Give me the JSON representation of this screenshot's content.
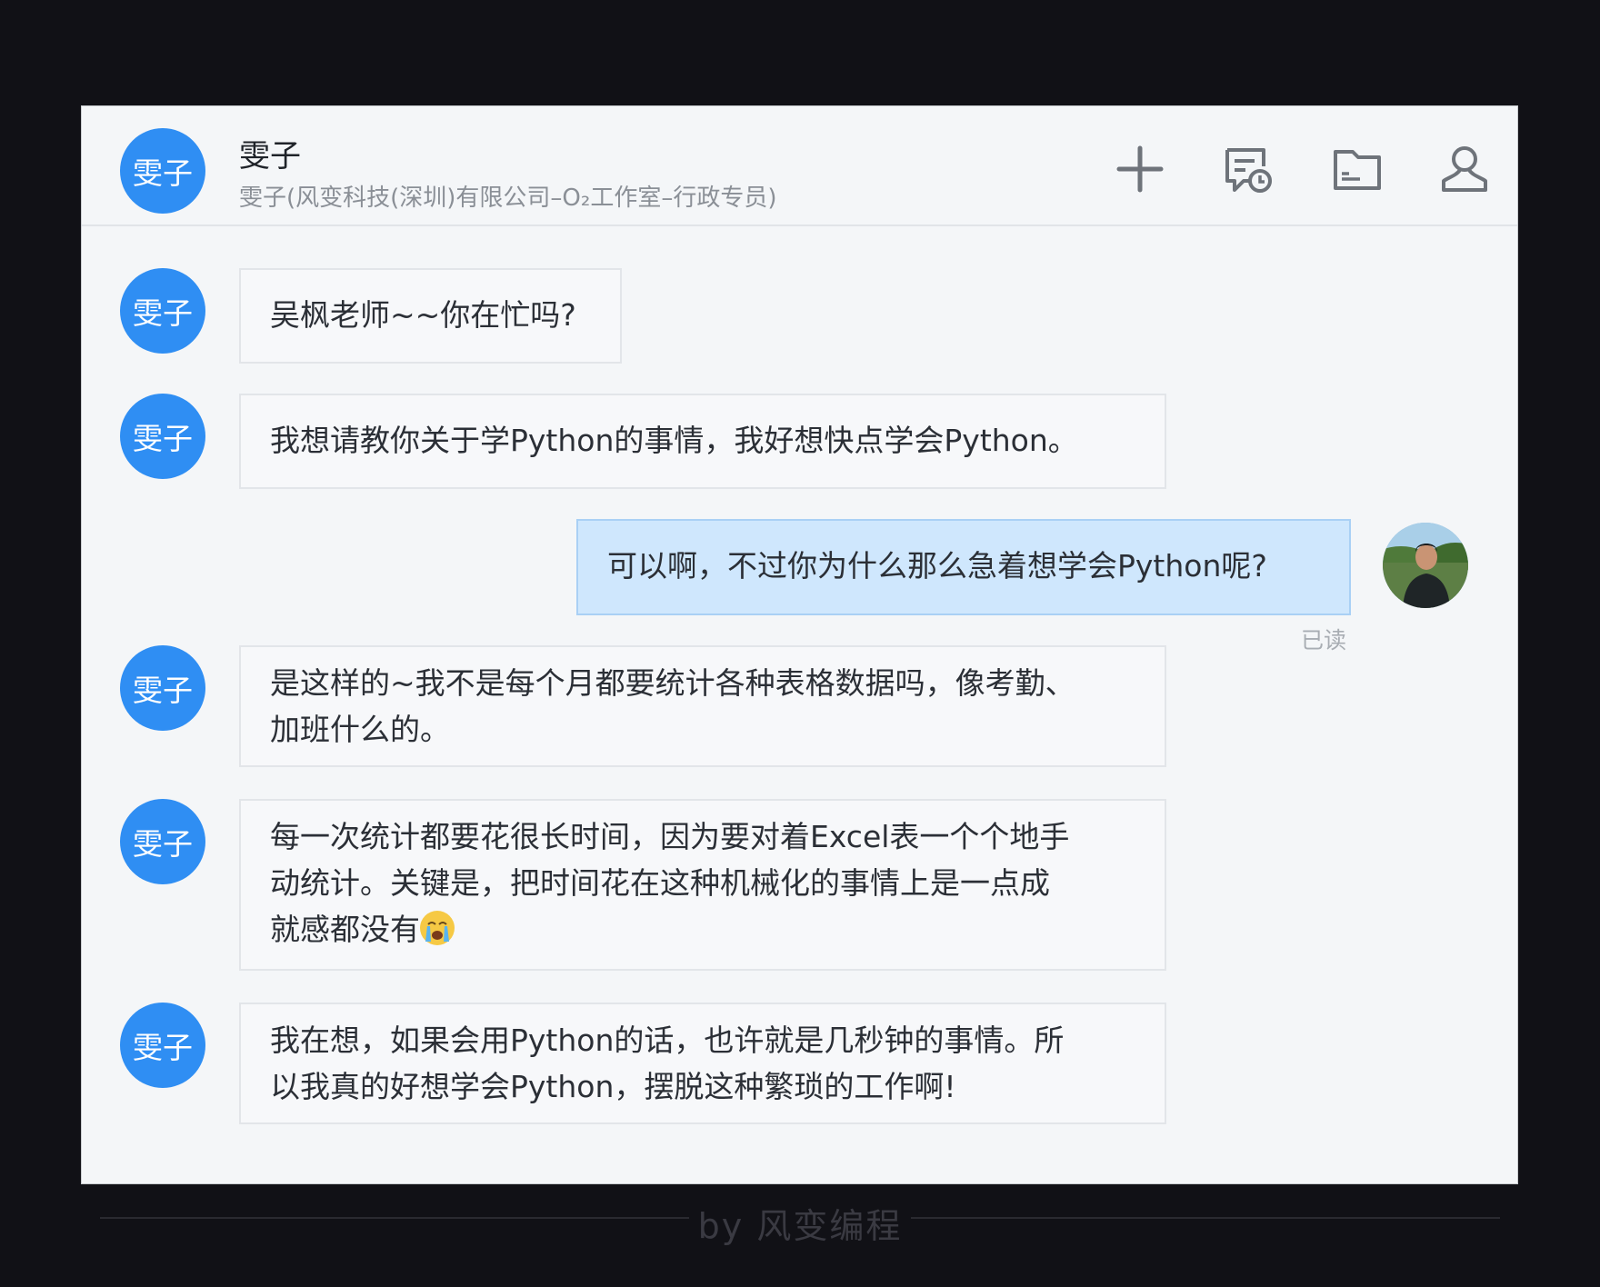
{
  "contact": {
    "avatar_text": "雯子",
    "name": "雯子",
    "subtitle": "雯子(风变科技(深圳)有限公司–O₂工作室–行政专员)"
  },
  "header_icons": [
    "plus-icon",
    "chat-history-icon",
    "folder-icon",
    "user-profile-icon"
  ],
  "messages": [
    {
      "sender": "雯子",
      "avatar_text": "雯子",
      "text": "吴枫老师~~你在忙吗?"
    },
    {
      "sender": "雯子",
      "avatar_text": "雯子",
      "text": "我想请教你关于学Python的事情，我好想快点学会Python。"
    },
    {
      "sender": "self",
      "text": "可以啊，不过你为什么那么急着想学会Python呢?",
      "status": "已读"
    },
    {
      "sender": "雯子",
      "avatar_text": "雯子",
      "line1": "是这样的~我不是每个月都要统计各种表格数据吗，像考勤、",
      "line2": "加班什么的。"
    },
    {
      "sender": "雯子",
      "avatar_text": "雯子",
      "line1": "每一次统计都要花很长时间，因为要对着Excel表一个个地手",
      "line2": "动统计。关键是，把时间花在这种机械化的事情上是一点成",
      "line3": "就感都没有"
    },
    {
      "sender": "雯子",
      "avatar_text": "雯子",
      "line1": "我在想，如果会用Python的话，也许就是几秒钟的事情。所",
      "line2": "以我真的好想学会Python，摆脱这种繁琐的工作啊!"
    }
  ],
  "footer": {
    "text": "by 风变编程"
  },
  "colors": {
    "accent": "#2f8ef3",
    "self_bubble": "#cfe7fd",
    "page_bg": "#111116"
  }
}
